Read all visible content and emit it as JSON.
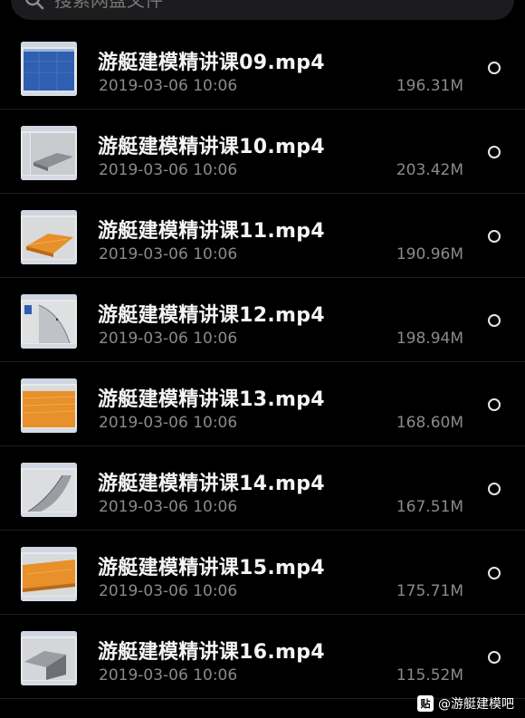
{
  "search": {
    "placeholder": "搜索网盘文件",
    "icon": "search-icon"
  },
  "files": [
    {
      "name": "游艇建模精讲课09.mp4",
      "date": "2019-03-06 10:06",
      "size": "196.31M",
      "thumbnail": "video-thumbnail-icon"
    },
    {
      "name": "游艇建模精讲课10.mp4",
      "date": "2019-03-06 10:06",
      "size": "203.42M",
      "thumbnail": "video-thumbnail-icon"
    },
    {
      "name": "游艇建模精讲课11.mp4",
      "date": "2019-03-06 10:06",
      "size": "190.96M",
      "thumbnail": "video-thumbnail-icon"
    },
    {
      "name": "游艇建模精讲课12.mp4",
      "date": "2019-03-06 10:06",
      "size": "198.94M",
      "thumbnail": "video-thumbnail-icon"
    },
    {
      "name": "游艇建模精讲课13.mp4",
      "date": "2019-03-06 10:06",
      "size": "168.60M",
      "thumbnail": "video-thumbnail-icon"
    },
    {
      "name": "游艇建模精讲课14.mp4",
      "date": "2019-03-06 10:06",
      "size": "167.51M",
      "thumbnail": "video-thumbnail-icon"
    },
    {
      "name": "游艇建模精讲课15.mp4",
      "date": "2019-03-06 10:06",
      "size": "175.71M",
      "thumbnail": "video-thumbnail-icon"
    },
    {
      "name": "游艇建模精讲课16.mp4",
      "date": "2019-03-06 10:06",
      "size": "115.52M",
      "thumbnail": "video-thumbnail-icon"
    }
  ],
  "watermark": {
    "logo": "贴",
    "text": "@游艇建模吧"
  },
  "colors": {
    "background": "#000000",
    "search_bg": "#1c1c1e",
    "title_text": "#f4f4f4",
    "meta_text": "#8a8a8e",
    "accent_orange": "#e8902a",
    "thumb_blue": "#2f5fb0"
  }
}
